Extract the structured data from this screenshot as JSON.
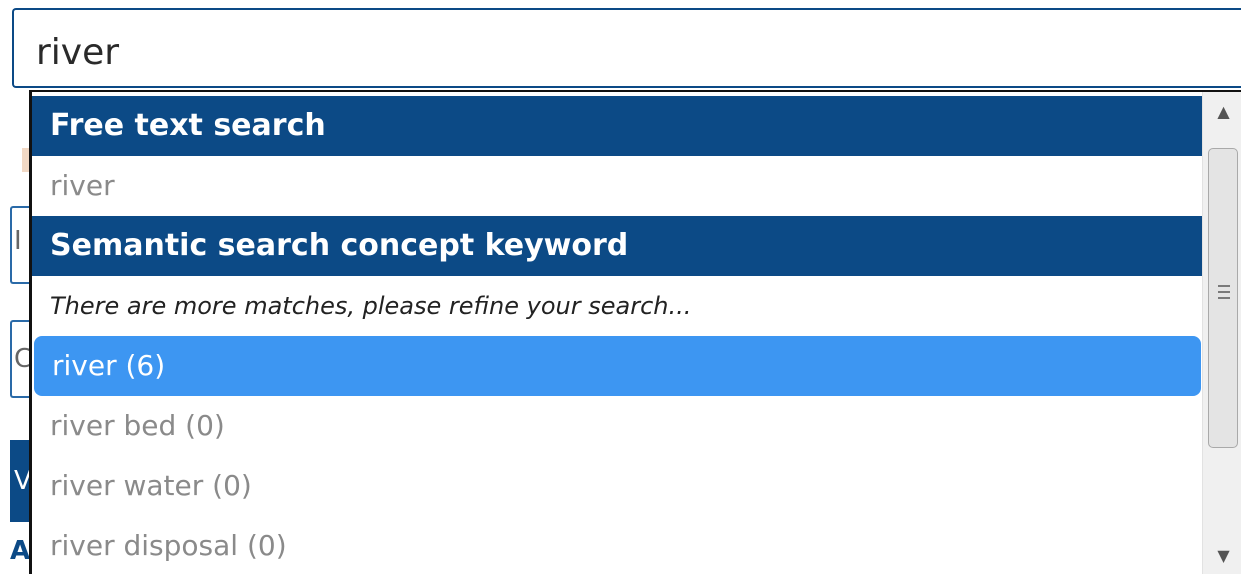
{
  "search": {
    "value": "river"
  },
  "background": {
    "fragment_1": "I",
    "fragment_2": "C",
    "fragment_3": "V",
    "fragment_4": "A"
  },
  "dropdown": {
    "groups": [
      {
        "header": "Free text search",
        "items": [
          {
            "label": "river"
          }
        ]
      },
      {
        "header": "Semantic search concept keyword",
        "note": "There are more matches, please refine your search...",
        "items": [
          {
            "label": "river (6)",
            "selected": true
          },
          {
            "label": "river bed (0)"
          },
          {
            "label": "river water (0)"
          },
          {
            "label": "river disposal (0)"
          }
        ]
      }
    ]
  },
  "scrollbar": {
    "up_icon": "scroll-up-arrow-icon",
    "down_icon": "scroll-down-arrow-icon"
  },
  "colors": {
    "header_bg": "#0c4a86",
    "selected_bg": "#3d96f2",
    "item_text": "#8a8a8a"
  }
}
